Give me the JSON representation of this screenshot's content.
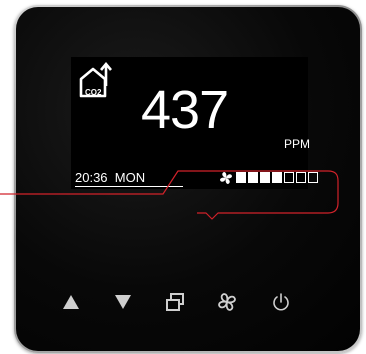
{
  "display": {
    "co2_label": "CO2",
    "reading": "437",
    "unit": "PPM",
    "time": "20:36",
    "day": "MON",
    "fan_level": {
      "filled": 4,
      "total": 7
    }
  },
  "buttons": [
    {
      "name": "up-button",
      "icon": "triangle-up-icon"
    },
    {
      "name": "down-button",
      "icon": "triangle-down-icon"
    },
    {
      "name": "mode-button",
      "icon": "windows-icon"
    },
    {
      "name": "fan-button",
      "icon": "fan-icon"
    },
    {
      "name": "power-button",
      "icon": "power-icon"
    }
  ],
  "colors": {
    "callout": "#d1222a",
    "display_text": "#ffffff",
    "button_icon": "#d0d0d0"
  }
}
